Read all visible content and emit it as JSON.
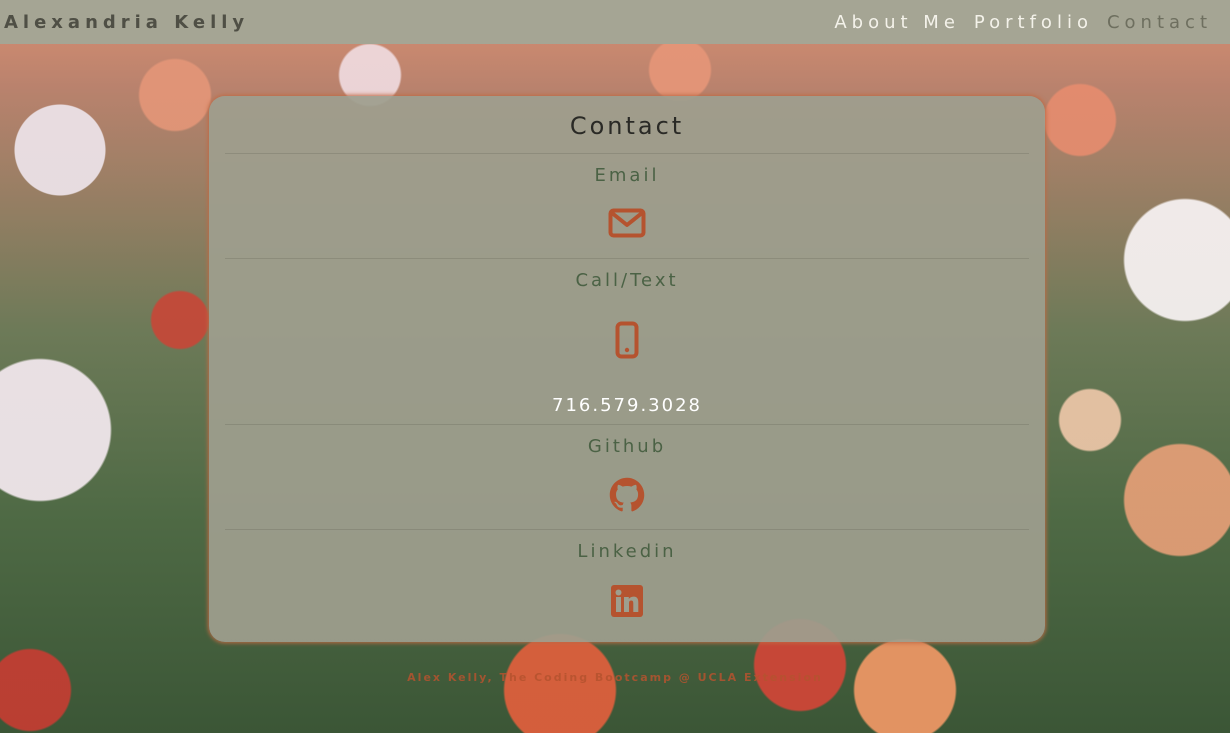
{
  "navbar": {
    "brand": "Alexandria Kelly",
    "links": [
      {
        "label": "About Me",
        "active": false
      },
      {
        "label": "Portfolio",
        "active": false
      },
      {
        "label": "Contact",
        "active": true
      }
    ]
  },
  "card": {
    "title": "Contact",
    "sections": [
      {
        "label": "Email",
        "icon": "envelope-icon"
      },
      {
        "label": "Call/Text",
        "icon": "mobile-phone-icon",
        "value": "716.579.3028"
      },
      {
        "label": "Github",
        "icon": "github-icon"
      },
      {
        "label": "Linkedin",
        "icon": "linkedin-icon"
      }
    ]
  },
  "footer": {
    "text": "Alex Kelly, The Coding Bootcamp @ UCLA Extension"
  },
  "colors": {
    "navbar_bg": "#a5a594",
    "accent": "#b5532f",
    "label_green": "#4b6245",
    "card_bg": "#9e9e8e"
  }
}
